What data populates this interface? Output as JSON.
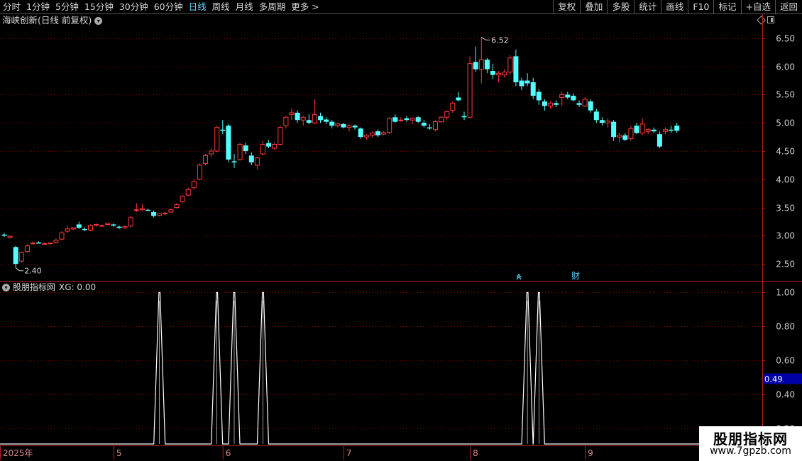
{
  "toolbar": {
    "periods": [
      "分时",
      "1分钟",
      "5分钟",
      "15分钟",
      "30分钟",
      "60分钟",
      "日线",
      "周线",
      "月线",
      "多周期"
    ],
    "active_period": "日线",
    "more": "更多 >",
    "right_buttons": [
      "复权",
      "叠加",
      "多股",
      "统计",
      "画线",
      "F10",
      "标记",
      "+自选",
      "返回"
    ]
  },
  "main_chart": {
    "title": "海峡创新(日线 前复权)",
    "high_label": "6.52",
    "low_label": "2.40",
    "markers": [
      "财"
    ],
    "colors": {
      "up": "#ff3b3b",
      "down": "#54ffff",
      "grid": "#8b0000",
      "axis": "#b02020"
    }
  },
  "indicator": {
    "title": "股朋指标网",
    "readout": "XG: 0.00",
    "cursor_value": "0.49",
    "colors": {
      "line": "#ffffff",
      "cursor_bg": "#0000a8"
    }
  },
  "watermark": {
    "line1": "股朋指标网",
    "line2": "www.7gpzb.com"
  },
  "chart_data": [
    {
      "type": "candlestick",
      "title": "海峡创新(日线 前复权)",
      "ylim": [
        2.2,
        6.7
      ],
      "ticks": [
        "6.50",
        "6.00",
        "5.50",
        "5.00",
        "4.50",
        "4.00",
        "3.50",
        "3.00",
        "2.50"
      ],
      "x_labels": [
        "2025年",
        "5",
        "6",
        "7",
        "8",
        "9"
      ],
      "annotations": [
        "6.52",
        "2.40"
      ],
      "candles": [
        [
          3.02,
          3.05,
          2.98,
          3.0
        ],
        [
          2.97,
          3.0,
          2.95,
          2.99
        ],
        [
          2.8,
          2.82,
          2.43,
          2.5
        ],
        [
          2.55,
          2.72,
          2.52,
          2.7
        ],
        [
          2.72,
          2.85,
          2.7,
          2.82
        ],
        [
          2.86,
          2.9,
          2.84,
          2.87
        ],
        [
          2.88,
          2.9,
          2.86,
          2.86
        ],
        [
          2.85,
          2.88,
          2.84,
          2.86
        ],
        [
          2.86,
          2.88,
          2.84,
          2.87
        ],
        [
          2.88,
          2.95,
          2.86,
          2.92
        ],
        [
          2.94,
          3.08,
          2.92,
          3.05
        ],
        [
          3.08,
          3.18,
          3.05,
          3.12
        ],
        [
          3.12,
          3.15,
          3.1,
          3.14
        ],
        [
          3.2,
          3.25,
          3.12,
          3.14
        ],
        [
          3.12,
          3.15,
          3.08,
          3.1
        ],
        [
          3.1,
          3.2,
          3.08,
          3.18
        ],
        [
          3.2,
          3.22,
          3.16,
          3.2
        ],
        [
          3.18,
          3.2,
          3.16,
          3.18
        ],
        [
          3.2,
          3.22,
          3.18,
          3.22
        ],
        [
          3.2,
          3.22,
          3.16,
          3.18
        ],
        [
          3.16,
          3.18,
          3.12,
          3.14
        ],
        [
          3.14,
          3.18,
          3.12,
          3.16
        ],
        [
          3.17,
          3.35,
          3.15,
          3.32
        ],
        [
          3.45,
          3.58,
          3.42,
          3.46
        ],
        [
          3.46,
          3.56,
          3.44,
          3.48
        ],
        [
          3.46,
          3.48,
          3.44,
          3.44
        ],
        [
          3.42,
          3.45,
          3.32,
          3.35
        ],
        [
          3.36,
          3.4,
          3.34,
          3.39
        ],
        [
          3.39,
          3.42,
          3.36,
          3.4
        ],
        [
          3.42,
          3.48,
          3.4,
          3.46
        ],
        [
          3.5,
          3.58,
          3.48,
          3.55
        ],
        [
          3.6,
          3.72,
          3.58,
          3.7
        ],
        [
          3.72,
          3.85,
          3.7,
          3.82
        ],
        [
          3.85,
          4.0,
          3.83,
          3.96
        ],
        [
          4.0,
          4.28,
          3.98,
          4.25
        ],
        [
          4.28,
          4.45,
          4.25,
          4.42
        ],
        [
          4.45,
          4.55,
          4.4,
          4.5
        ],
        [
          4.5,
          4.95,
          4.48,
          4.92
        ],
        [
          4.88,
          5.05,
          4.8,
          4.86
        ],
        [
          4.95,
          4.98,
          4.3,
          4.35
        ],
        [
          4.32,
          4.45,
          4.2,
          4.3
        ],
        [
          4.35,
          4.65,
          4.33,
          4.62
        ],
        [
          4.6,
          4.65,
          4.45,
          4.5
        ],
        [
          4.42,
          4.48,
          4.25,
          4.3
        ],
        [
          4.25,
          4.4,
          4.18,
          4.38
        ],
        [
          4.45,
          4.68,
          4.42,
          4.62
        ],
        [
          4.64,
          4.7,
          4.55,
          4.58
        ],
        [
          4.55,
          4.65,
          4.52,
          4.62
        ],
        [
          4.62,
          4.95,
          4.6,
          4.92
        ],
        [
          4.95,
          5.12,
          4.9,
          5.1
        ],
        [
          5.15,
          5.25,
          5.05,
          5.18
        ],
        [
          5.18,
          5.22,
          5.0,
          5.05
        ],
        [
          5.05,
          5.12,
          4.95,
          5.1
        ],
        [
          5.05,
          5.15,
          4.98,
          5.0
        ],
        [
          5.0,
          5.42,
          4.98,
          5.15
        ],
        [
          5.12,
          5.18,
          5.0,
          5.05
        ],
        [
          5.06,
          5.1,
          4.98,
          5.02
        ],
        [
          5.02,
          5.05,
          4.9,
          4.95
        ],
        [
          4.95,
          5.0,
          4.92,
          4.98
        ],
        [
          4.98,
          5.0,
          4.9,
          4.92
        ],
        [
          4.92,
          4.98,
          4.85,
          4.95
        ],
        [
          4.95,
          4.97,
          4.88,
          4.92
        ],
        [
          4.9,
          4.92,
          4.72,
          4.75
        ],
        [
          4.75,
          4.8,
          4.7,
          4.78
        ],
        [
          4.78,
          4.85,
          4.75,
          4.82
        ],
        [
          4.85,
          4.88,
          4.75,
          4.78
        ],
        [
          4.8,
          4.85,
          4.78,
          4.83
        ],
        [
          4.83,
          5.1,
          4.8,
          5.08
        ],
        [
          5.1,
          5.15,
          5.0,
          5.02
        ],
        [
          5.05,
          5.1,
          5.02,
          5.05
        ],
        [
          5.08,
          5.12,
          5.02,
          5.05
        ],
        [
          5.05,
          5.1,
          4.98,
          5.08
        ],
        [
          5.1,
          5.12,
          5.0,
          5.02
        ],
        [
          5.0,
          5.05,
          4.92,
          4.95
        ],
        [
          4.92,
          4.98,
          4.88,
          4.9
        ],
        [
          4.88,
          5.05,
          4.85,
          5.02
        ],
        [
          5.02,
          5.12,
          5.0,
          5.1
        ],
        [
          5.1,
          5.22,
          5.05,
          5.2
        ],
        [
          5.22,
          5.38,
          5.18,
          5.35
        ],
        [
          5.45,
          5.55,
          5.38,
          5.4
        ],
        [
          5.12,
          5.2,
          5.05,
          5.1
        ],
        [
          5.1,
          6.18,
          5.08,
          6.05
        ],
        [
          6.08,
          6.35,
          5.9,
          5.95
        ],
        [
          5.95,
          6.52,
          5.7,
          6.12
        ],
        [
          6.12,
          6.15,
          5.88,
          5.95
        ],
        [
          5.92,
          6.05,
          5.78,
          5.85
        ],
        [
          5.85,
          5.92,
          5.72,
          5.88
        ],
        [
          5.85,
          5.95,
          5.8,
          5.9
        ],
        [
          5.9,
          6.2,
          5.85,
          6.15
        ],
        [
          6.18,
          6.3,
          5.65,
          5.72
        ],
        [
          5.75,
          5.8,
          5.58,
          5.65
        ],
        [
          5.75,
          5.88,
          5.65,
          5.7
        ],
        [
          5.72,
          5.8,
          5.42,
          5.48
        ],
        [
          5.55,
          5.6,
          5.32,
          5.4
        ],
        [
          5.38,
          5.42,
          5.22,
          5.3
        ],
        [
          5.3,
          5.38,
          5.25,
          5.35
        ],
        [
          5.35,
          5.4,
          5.28,
          5.32
        ],
        [
          5.45,
          5.55,
          5.3,
          5.5
        ],
        [
          5.5,
          5.55,
          5.42,
          5.45
        ],
        [
          5.48,
          5.52,
          5.38,
          5.4
        ],
        [
          5.35,
          5.4,
          5.28,
          5.32
        ],
        [
          5.3,
          5.45,
          5.28,
          5.42
        ],
        [
          5.38,
          5.42,
          5.18,
          5.22
        ],
        [
          5.2,
          5.25,
          5.0,
          5.05
        ],
        [
          5.05,
          5.1,
          4.95,
          5.0
        ],
        [
          5.0,
          5.08,
          4.92,
          5.03
        ],
        [
          5.02,
          5.05,
          4.68,
          4.75
        ],
        [
          4.75,
          4.82,
          4.65,
          4.78
        ],
        [
          4.78,
          4.82,
          4.68,
          4.7
        ],
        [
          4.72,
          4.95,
          4.68,
          4.9
        ],
        [
          4.95,
          5.0,
          4.8,
          4.82
        ],
        [
          4.82,
          5.08,
          4.78,
          4.98
        ],
        [
          4.85,
          4.9,
          4.8,
          4.88
        ],
        [
          4.88,
          4.92,
          4.82,
          4.85
        ],
        [
          4.8,
          4.85,
          4.55,
          4.58
        ],
        [
          4.85,
          4.92,
          4.8,
          4.88
        ],
        [
          4.88,
          4.95,
          4.82,
          4.86
        ],
        [
          4.95,
          5.0,
          4.82,
          4.86
        ]
      ]
    },
    {
      "type": "line",
      "title": "股朋指标网",
      "series_name": "XG",
      "ylim": [
        0.1,
        1.06
      ],
      "ticks": [
        "1.00",
        "0.80",
        "0.60",
        "0.40",
        "0.20"
      ],
      "signal_days": [
        27,
        37,
        40,
        45,
        91,
        93
      ],
      "values": [
        0,
        1
      ]
    }
  ]
}
